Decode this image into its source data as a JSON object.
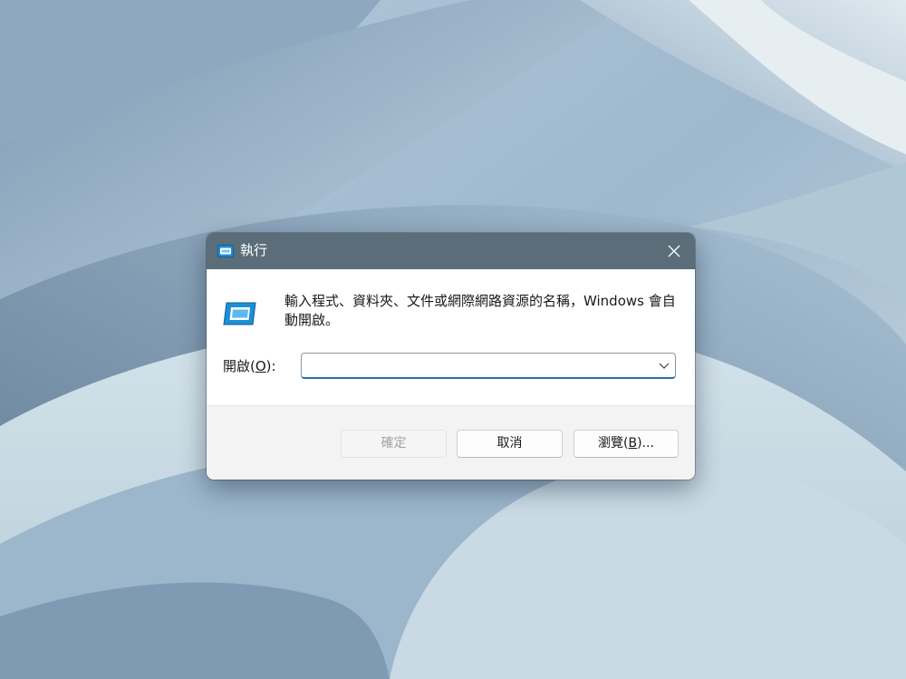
{
  "dialog": {
    "title": "執行",
    "description": "輸入程式、資料夾、文件或網際網路資源的名稱，Windows 會自動開啟。",
    "open_label_prefix": "開啟(",
    "open_label_hotkey": "O",
    "open_label_suffix": "):",
    "open_input_value": "",
    "buttons": {
      "ok": "確定",
      "cancel": "取消",
      "browse_prefix": "瀏覽(",
      "browse_hotkey": "B",
      "browse_suffix": ")..."
    }
  },
  "icons": {
    "title": "run-app-icon",
    "content": "run-app-icon",
    "close": "close-icon",
    "dropdown": "chevron-down-icon"
  },
  "colors": {
    "title_bar": "#5a6d78",
    "content_bg": "#ffffff",
    "button_bar_bg": "#f3f3f3",
    "input_focus_border": "#2f6fa8",
    "icon_accent": "#1c8fd6"
  }
}
